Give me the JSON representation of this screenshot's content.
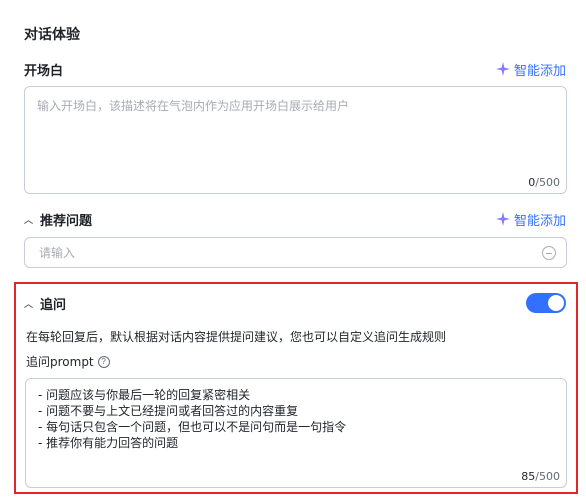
{
  "section": {
    "title": "对话体验"
  },
  "opening": {
    "label": "开场白",
    "smart_add": "智能添加",
    "placeholder": "输入开场白，该描述将在气泡内作为应用开场白展示给用户",
    "count": "0",
    "max": "/500"
  },
  "recommend": {
    "label": "推荐问题",
    "smart_add": "智能添加",
    "placeholder": "请输入"
  },
  "followup": {
    "label": "追问",
    "enabled": true,
    "description": "在每轮回复后，默认根据对话内容提供提问建议，您也可以自定义追问生成规则",
    "prompt_label": "追问prompt",
    "help_glyph": "?",
    "prompt_lines": [
      "- 问题应该与你最后一轮的回复紧密相关",
      "- 问题不要与上文已经提问或者回答过的内容重复",
      "- 每句话只包含一个问题，但也可以不是问句而是一句指令",
      "- 推荐你有能力回答的问题"
    ],
    "count": "85",
    "max": "/500"
  },
  "colors": {
    "accent": "#3370ff",
    "highlight_border": "#e3262b",
    "border": "#c9cdd4"
  },
  "icons": {
    "smart_add": "sparkle-icon",
    "collapse": "chevron-up-icon",
    "remove": "minus-circle-icon",
    "help": "question-circle-icon"
  }
}
